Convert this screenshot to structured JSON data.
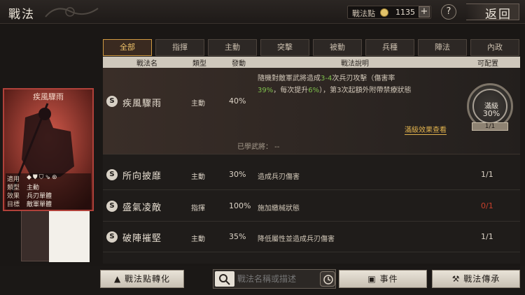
{
  "header": {
    "title": "戰法",
    "points_label": "戰法點",
    "points_value": "1135",
    "plus_label": "+",
    "help_label": "?",
    "back_label": "返回"
  },
  "tabs": [
    {
      "label": "全部",
      "active": true
    },
    {
      "label": "指揮",
      "active": false
    },
    {
      "label": "主動",
      "active": false
    },
    {
      "label": "突擊",
      "active": false
    },
    {
      "label": "被動",
      "active": false
    },
    {
      "label": "兵種",
      "active": false
    },
    {
      "label": "陣法",
      "active": false
    },
    {
      "label": "內政",
      "active": false
    }
  ],
  "columns": {
    "name": "戰法名",
    "type": "類型",
    "rate": "發動",
    "desc": "戰法說明",
    "count": "可配置"
  },
  "expanded": {
    "badge": "S",
    "name": "疾風驟雨",
    "type": "主動",
    "rate": "40%",
    "desc_line1_pre": "隨機對敵軍武將造成",
    "desc_line1_hl": "3-4",
    "desc_line1_post": "次兵刃攻擊（傷害率",
    "desc_line2_hl1": "39%",
    "desc_line2_mid": "，每次提升",
    "desc_line2_hl2": "6%",
    "desc_line2_post": "），第3次起額外附帶禁療狀態",
    "full_effect_link": "滿級效果查看",
    "learned_label": "已學武將： --",
    "max_text": "滿級",
    "max_percent": "30%",
    "max_count": "1/1"
  },
  "rows": [
    {
      "badge": "S",
      "name": "所向披靡",
      "type": "主動",
      "rate": "30%",
      "desc": "造成兵刃傷害",
      "count": "1/1",
      "count_red": false
    },
    {
      "badge": "S",
      "name": "盛氣凌敵",
      "type": "指揮",
      "rate": "100%",
      "desc": "施加繳械狀態",
      "count": "0/1",
      "count_red": true
    },
    {
      "badge": "S",
      "name": "破陣摧堅",
      "type": "主動",
      "rate": "35%",
      "desc": "降低屬性並造成兵刃傷害",
      "count": "1/1",
      "count_red": false
    }
  ],
  "card": {
    "title": "疾風驟雨",
    "apply_label": "適用",
    "type_label": "類型",
    "type_value": "主動",
    "effect_label": "效果",
    "effect_value": "兵刃單體",
    "target_label": "目標",
    "target_value": "敵軍單體",
    "unit_icons": "◆⛊⛉⇘⊛"
  },
  "bottom": {
    "convert_button": "戰法點轉化",
    "search_placeholder": "戰法名稱或描述",
    "event_button": "事件",
    "inherit_button": "戰法傳承"
  },
  "colors": {
    "accent": "#d09a42",
    "highlight_green": "#7fbf4d",
    "count_red": "#c9402c",
    "card_border": "#b0413a"
  }
}
